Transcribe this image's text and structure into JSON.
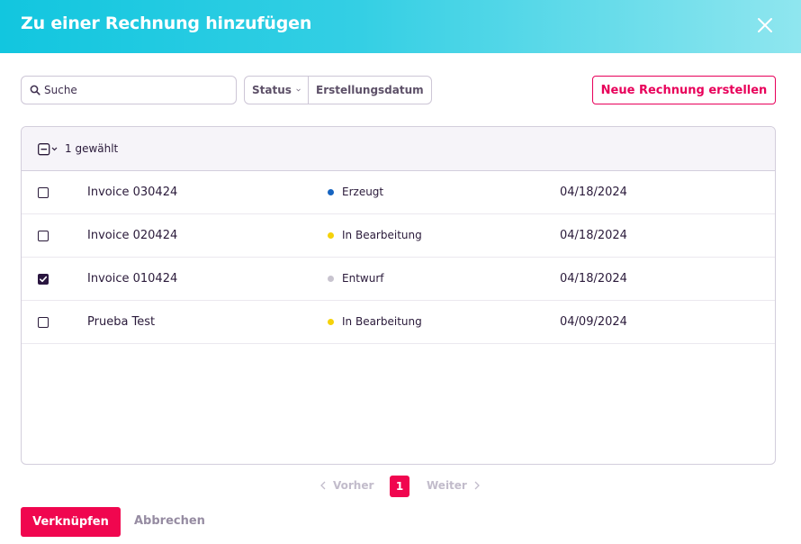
{
  "modal": {
    "title": "Zu einer Rechnung hinzufügen"
  },
  "toolbar": {
    "search_placeholder": "Suche",
    "search_value": "",
    "filter_status": "Status",
    "filter_date": "Erstellungsdatum",
    "new_invoice": "Neue Rechnung erstellen"
  },
  "table": {
    "selected_count": "1 gewählt",
    "rows": [
      {
        "name": "Invoice 030424",
        "status": "Erzeugt",
        "status_color": "#1664c0",
        "date": "04/18/2024",
        "checked": false
      },
      {
        "name": "Invoice 020424",
        "status": "In Bearbeitung",
        "status_color": "#f5d20a",
        "date": "04/18/2024",
        "checked": false
      },
      {
        "name": "Invoice 010424",
        "status": "Entwurf",
        "status_color": "#c8c4cf",
        "date": "04/18/2024",
        "checked": true
      },
      {
        "name": "Prueba Test",
        "status": "In Bearbeitung",
        "status_color": "#f5d20a",
        "date": "04/09/2024",
        "checked": false
      }
    ]
  },
  "pagination": {
    "prev": "Vorher",
    "current": "1",
    "next": "Weiter"
  },
  "footer": {
    "link_label": "Verknüpfen",
    "cancel_label": "Abbrechen"
  },
  "colors": {
    "accent": "#f0064f",
    "header_start": "#12c6df",
    "header_end": "#8fe6ef"
  }
}
